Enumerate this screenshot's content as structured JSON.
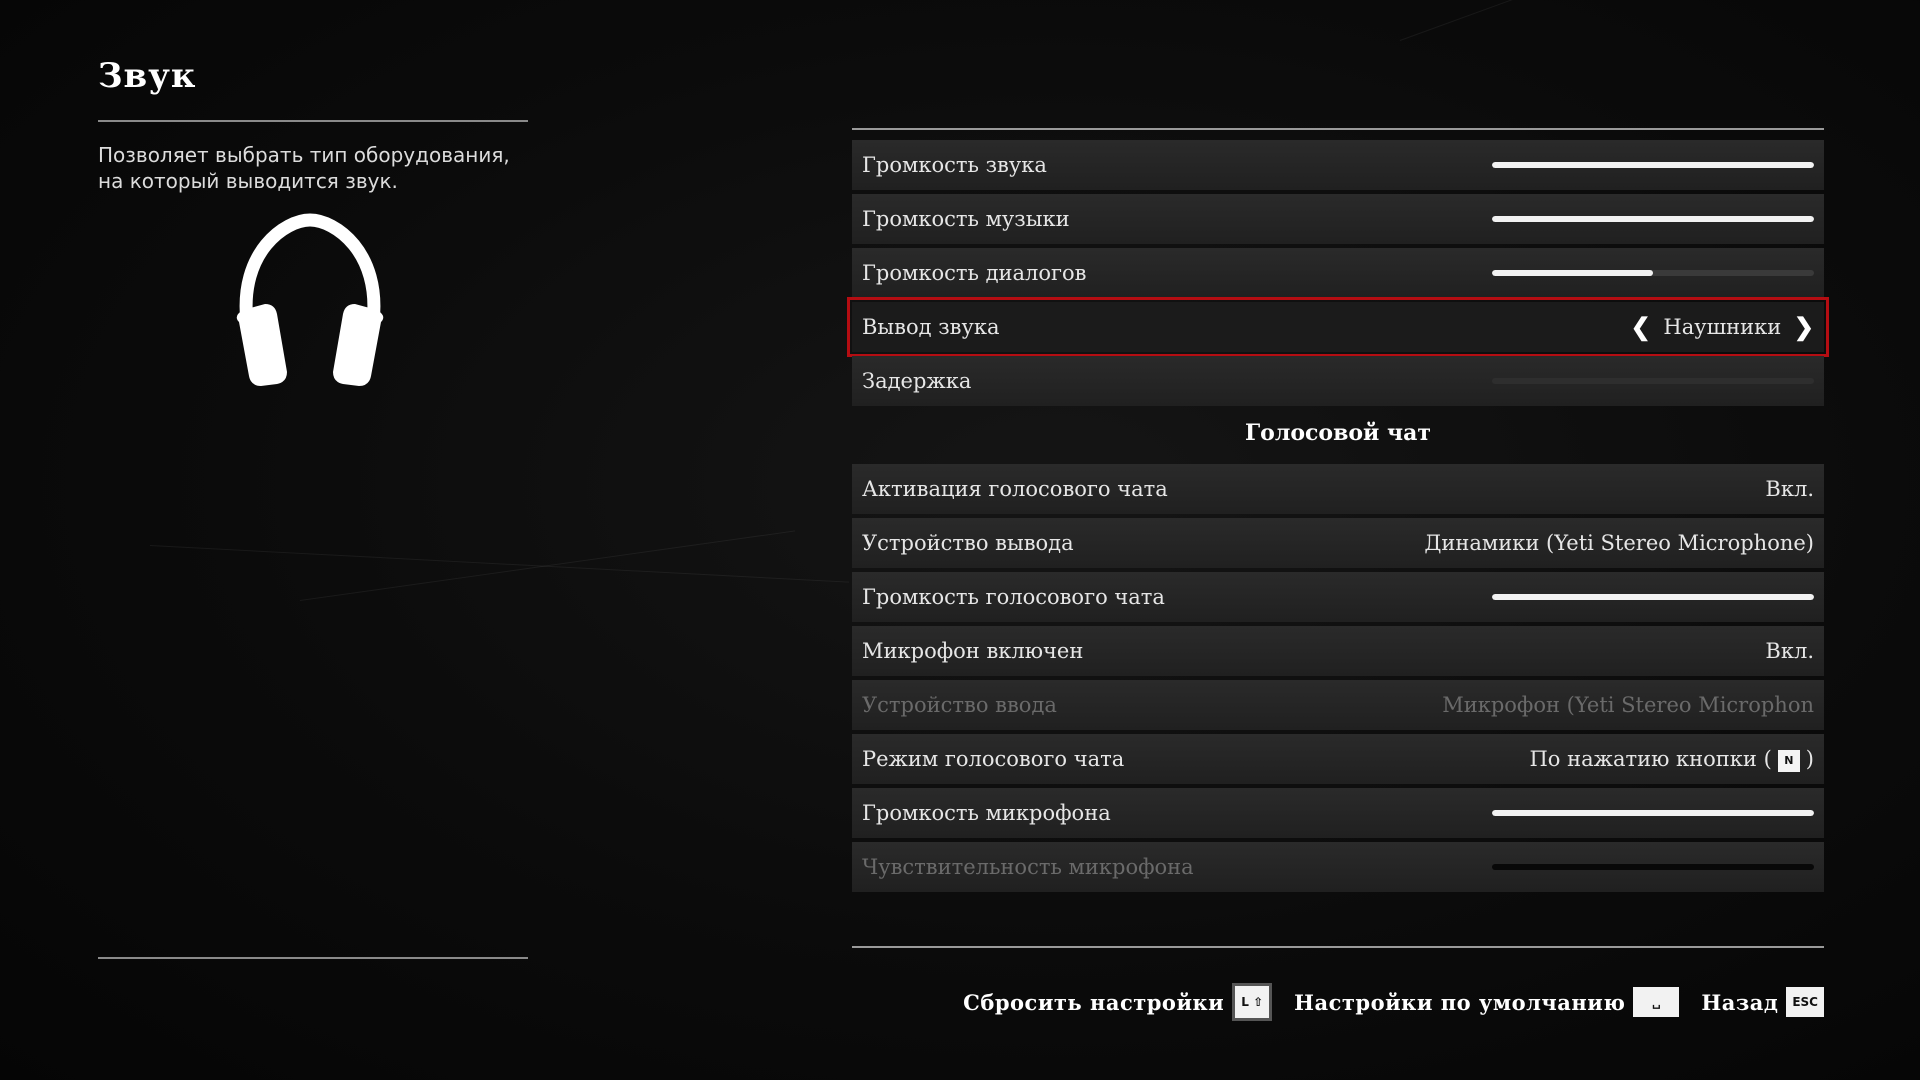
{
  "panel": {
    "title": "Звук",
    "description": "Позволяет выбрать тип оборудования, на который выводится звук."
  },
  "settings": [
    {
      "label": "Громкость звука",
      "type": "slider",
      "level": 1.0
    },
    {
      "label": "Громкость музыки",
      "type": "slider",
      "level": 1.0
    },
    {
      "label": "Громкость диалогов",
      "type": "slider",
      "level": 0.5
    },
    {
      "label": "Вывод звука",
      "type": "selector",
      "value": "Наушники",
      "selected": true
    },
    {
      "label": "Задержка",
      "type": "slider",
      "level": 0.0
    }
  ],
  "voice_section": {
    "title": "Голосовой чат"
  },
  "voice_settings": [
    {
      "label": "Активация голосового чата",
      "type": "text",
      "value": "Вкл."
    },
    {
      "label": "Устройство вывода",
      "type": "text",
      "value": "Динамики (Yeti Stereo Microphone)"
    },
    {
      "label": "Громкость голосового чата",
      "type": "slider",
      "level": 1.0
    },
    {
      "label": "Микрофон включен",
      "type": "text",
      "value": "Вкл."
    },
    {
      "label": "Устройство ввода",
      "type": "text",
      "value": "Микрофон (Yeti Stereo Microphon",
      "disabled": true
    },
    {
      "label": "Режим голосового чата",
      "type": "key",
      "value_prefix": "По нажатию кнопки (",
      "key": "N",
      "value_suffix": ")"
    },
    {
      "label": "Громкость микрофона",
      "type": "slider",
      "level": 1.0
    },
    {
      "label": "Чувствительность микрофона",
      "type": "slider",
      "level": 0.0,
      "disabled": true
    }
  ],
  "footer": {
    "reset_label": "Сбросить настройки",
    "reset_key": "L ⇧",
    "defaults_label": "Настройки по умолчанию",
    "defaults_key": "␣",
    "back_label": "Назад",
    "back_key": "ESC"
  },
  "colors": {
    "selection": "#b50d12",
    "background": "#0b0b0b",
    "row": "#242424"
  }
}
